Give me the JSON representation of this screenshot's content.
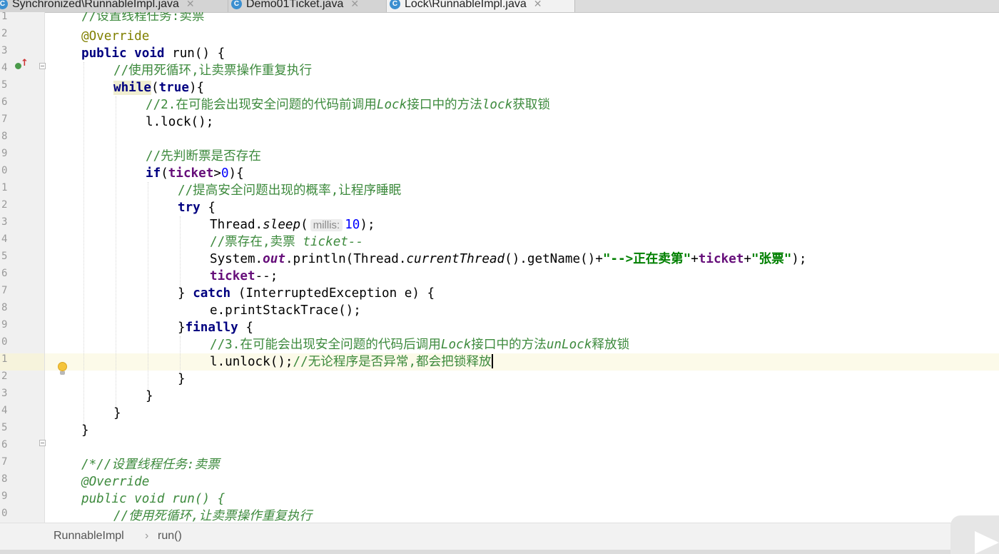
{
  "tabs": [
    {
      "label": "Synchronized\\RunnableImpl.java",
      "active": false
    },
    {
      "label": "Demo01Ticket.java",
      "active": false
    },
    {
      "label": "Lock\\RunnableImpl.java",
      "active": true
    }
  ],
  "line_numbers": [
    "1",
    "2",
    "3",
    "4",
    "5",
    "6",
    "7",
    "8",
    "9",
    "0",
    "1",
    "2",
    "3",
    "4",
    "5",
    "6",
    "7",
    "8",
    "9",
    "0",
    "1",
    "2",
    "3",
    "4",
    "5",
    "6",
    "7",
    "8",
    "9",
    "0"
  ],
  "code": {
    "l1": "//设置线程任务:卖票",
    "l2": "@Override",
    "l3_kw1": "public",
    "l3_kw2": "void",
    "l3_rest": " run() {",
    "l4": "//使用死循环,让卖票操作重复执行",
    "l5_kw": "while",
    "l5_kw2": "true",
    "l6_a": "//2.在可能会出现安全问题的代码前调用",
    "l6_b": "Lock",
    "l6_c": "接口中的方法",
    "l6_d": "lock",
    "l6_e": "获取锁",
    "l7": "l.lock();",
    "l9": "//先判断票是否存在",
    "l10_kw": "if",
    "l10_fld": "ticket",
    "l10_num": "0",
    "l11": "//提高安全问题出现的概率,让程序睡眠",
    "l12_kw": "try",
    "l13_a": "Thread.",
    "l13_m": "sleep",
    "l13_hint": "millis:",
    "l13_num": "10",
    "l14_a": "//票存在,卖票 ",
    "l14_b": "ticket--",
    "l15_a": "System.",
    "l15_out": "out",
    "l15_b": ".println(Thread.",
    "l15_m": "currentThread",
    "l15_c": "().getName()+",
    "l15_s1": "\"-->正在卖第\"",
    "l15_plus1": "+",
    "l15_fld": "ticket",
    "l15_plus2": "+",
    "l15_s2": "\"张票\"",
    "l15_end": ");",
    "l16_fld": "ticket",
    "l16_end": "--;",
    "l17_a": "} ",
    "l17_kw": "catch",
    "l17_b": " (InterruptedException e) {",
    "l18": "e.printStackTrace();",
    "l19_a": "}",
    "l19_kw": "finally",
    "l19_b": " {",
    "l20_a": "//3.在可能会出现安全问题的代码后调用",
    "l20_b": "Lock",
    "l20_c": "接口中的方法",
    "l20_d": "unLock",
    "l20_e": "释放锁",
    "l21_a": "l.unlock();",
    "l21_b": "//无论程序是否异常,都会把锁释放",
    "l22": "}",
    "l23": "}",
    "l24": "}",
    "l25": "}",
    "l27": "/*//设置线程任务:卖票",
    "l28": "@Override",
    "l29": "public void run() {",
    "l30": "//使用死循环,让卖票操作重复执行"
  },
  "breadcrumb": {
    "class_name": "RunnableImpl",
    "separator": "›",
    "method": "run()"
  },
  "colors": {
    "comment": "#3d8a3d",
    "keyword": "#000080",
    "string": "#008000",
    "field": "#660e7a",
    "number": "#0000ff"
  }
}
